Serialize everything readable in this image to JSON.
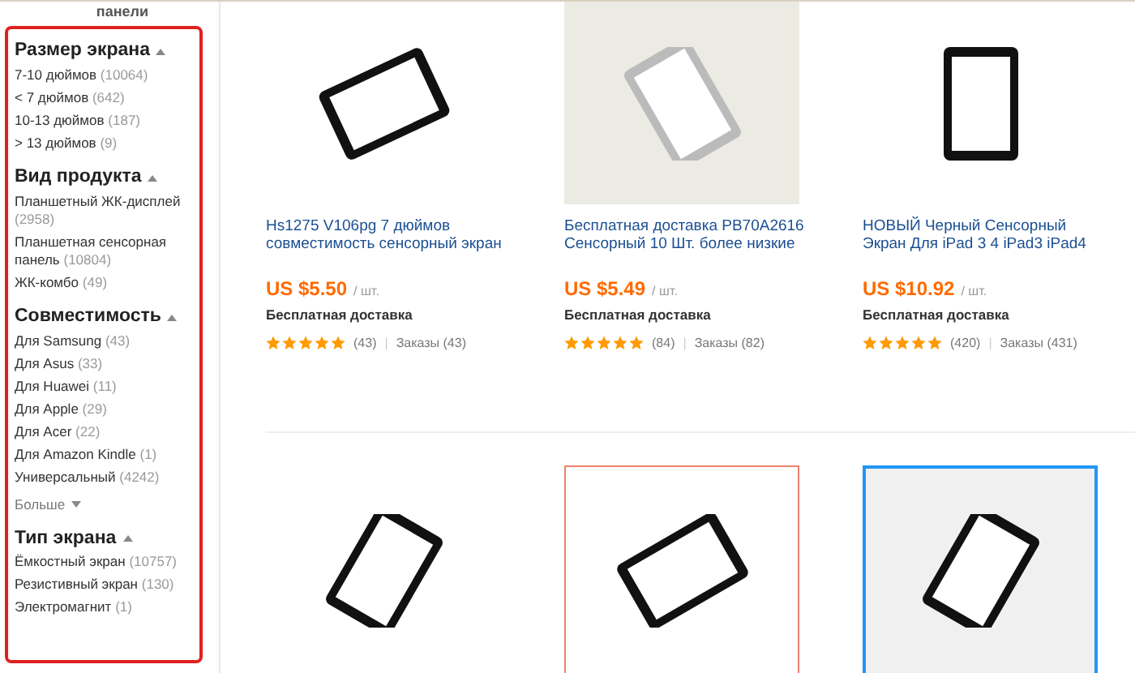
{
  "sidebar": {
    "top_label": "панели",
    "sections": [
      {
        "title": "Размер экрана",
        "expanded": true,
        "items": [
          {
            "label": "7-10 дюймов",
            "count": "(10064)"
          },
          {
            "label": "< 7 дюймов",
            "count": "(642)"
          },
          {
            "label": "10-13 дюймов",
            "count": "(187)"
          },
          {
            "label": "> 13 дюймов",
            "count": "(9)"
          }
        ]
      },
      {
        "title": "Вид продукта",
        "expanded": true,
        "items": [
          {
            "label": "Планшетный ЖК-дисплей",
            "count": "(2958)"
          },
          {
            "label": "Планшетная сенсорная панель",
            "count": "(10804)"
          },
          {
            "label": "ЖК-комбо",
            "count": "(49)"
          }
        ]
      },
      {
        "title": "Совместимость",
        "expanded": true,
        "items": [
          {
            "label": "Для Samsung",
            "count": "(43)"
          },
          {
            "label": "Для Asus",
            "count": "(33)"
          },
          {
            "label": "Для Huawei",
            "count": "(11)"
          },
          {
            "label": "Для Apple",
            "count": "(29)"
          },
          {
            "label": "Для Acer",
            "count": "(22)"
          },
          {
            "label": "Для Amazon Kindle",
            "count": "(1)"
          },
          {
            "label": "Универсальный",
            "count": "(4242)"
          }
        ],
        "more": "Больше"
      },
      {
        "title": "Тип экрана",
        "expanded": true,
        "items": [
          {
            "label": "Ёмкостный экран",
            "count": "(10757)"
          },
          {
            "label": "Резистивный экран",
            "count": "(130)"
          },
          {
            "label": "Электромагнит",
            "count": "(1)"
          }
        ]
      }
    ]
  },
  "products": [
    {
      "title": "Hs1275 V106pg 7 дюймов совместимость сенсорный экран",
      "price": "US $5.50",
      "unit": "/ шт.",
      "shipping": "Бесплатная доставка",
      "stars": 5,
      "reviews": "(43)",
      "separator": "|",
      "orders": "Заказы (43)"
    },
    {
      "title": "Бесплатная доставка PB70A2616 Сенсорный 10 Шт. более низкие",
      "price": "US $5.49",
      "unit": "/ шт.",
      "shipping": "Бесплатная доставка",
      "stars": 5,
      "reviews": "(84)",
      "separator": "|",
      "orders": "Заказы (82)"
    },
    {
      "title": "НОВЫЙ Черный Сенсорный Экран Для iPad 3 4 iPad3 iPad4",
      "price": "US $10.92",
      "unit": "/ шт.",
      "shipping": "Бесплатная доставка",
      "stars": 5,
      "reviews": "(420)",
      "separator": "|",
      "orders": "Заказы (431)"
    }
  ]
}
